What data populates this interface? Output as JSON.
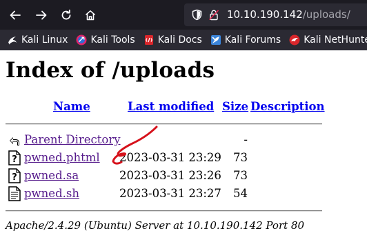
{
  "browser": {
    "url_host": "10.10.190.142",
    "url_path": "/uploads/"
  },
  "bookmarks": [
    {
      "label": "Kali Linux",
      "icon": "kali-dragon-icon"
    },
    {
      "label": "Kali Tools",
      "icon": "kali-tools-icon"
    },
    {
      "label": "Kali Docs",
      "icon": "kali-docs-icon"
    },
    {
      "label": "Kali Forums",
      "icon": "kali-forums-icon"
    },
    {
      "label": "Kali NetHunter",
      "icon": "kali-nethunter-icon"
    }
  ],
  "page": {
    "title": "Index of /uploads",
    "columns": {
      "name": "Name",
      "last_modified": "Last modified",
      "size": "Size",
      "description": "Description"
    },
    "rows": [
      {
        "name": "Parent Directory",
        "date": "",
        "size": "-",
        "icon": "back-arrow-icon"
      },
      {
        "name": "pwned.phtml",
        "date": "2023-03-31 23:29",
        "size": "73",
        "icon": "unknown-file-icon"
      },
      {
        "name": "pwned.sa",
        "date": "2023-03-31 23:26",
        "size": "73",
        "icon": "unknown-file-icon"
      },
      {
        "name": "pwned.sh",
        "date": "2023-03-31 23:27",
        "size": "54",
        "icon": "text-file-icon"
      }
    ],
    "footer": "Apache/2.4.29 (Ubuntu) Server at 10.10.190.142 Port 80"
  },
  "annotation_color": "#d6111b"
}
